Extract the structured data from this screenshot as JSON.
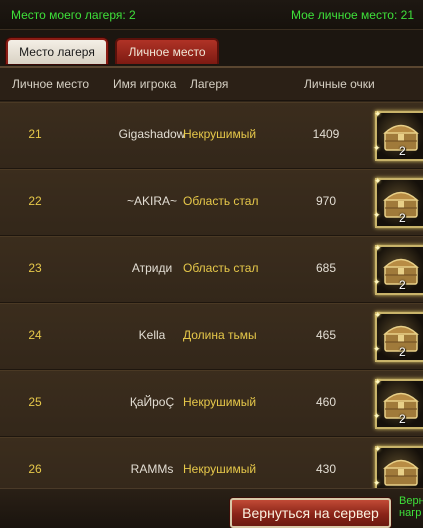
{
  "header": {
    "camp_rank_label": "Место моего лагеря: 2",
    "personal_rank_label": "Мое личное место: 21"
  },
  "tabs": [
    {
      "label": "Место лагеря",
      "active": true
    },
    {
      "label": "Личное место",
      "active": false
    }
  ],
  "table": {
    "columns": {
      "rank": "Личное место",
      "player": "Имя игрока",
      "camp": "Лагеря",
      "points": "Личные очки"
    },
    "rows": [
      {
        "rank": "21",
        "player": "Gigashadow",
        "camp": "Некрушимый",
        "points": "1409",
        "reward_qty": "2",
        "reward_icon": "treasure-chest-icon"
      },
      {
        "rank": "22",
        "player": "~AKIRA~",
        "camp": "Область стал",
        "points": "970",
        "reward_qty": "2",
        "reward_icon": "treasure-chest-icon"
      },
      {
        "rank": "23",
        "player": "Атриди",
        "camp": "Область стал",
        "points": "685",
        "reward_qty": "2",
        "reward_icon": "treasure-chest-icon"
      },
      {
        "rank": "24",
        "player": "Kella",
        "camp": "Долина тьмы",
        "points": "465",
        "reward_qty": "2",
        "reward_icon": "treasure-chest-icon"
      },
      {
        "rank": "25",
        "player": "ҚаЙроÇ",
        "camp": "Некрушимый",
        "points": "460",
        "reward_qty": "2",
        "reward_icon": "treasure-chest-icon"
      },
      {
        "rank": "26",
        "player": "RAMMs",
        "camp": "Некрушимый",
        "points": "430",
        "reward_qty": "",
        "reward_icon": "treasure-chest-icon"
      }
    ]
  },
  "footer": {
    "return_button": "Вернуться на сервер",
    "note_line1": "Верн",
    "note_line2": "нагр"
  },
  "colors": {
    "accent_green": "#3ee03a",
    "accent_gold": "#e6c84a",
    "button_red": "#8a2418"
  }
}
